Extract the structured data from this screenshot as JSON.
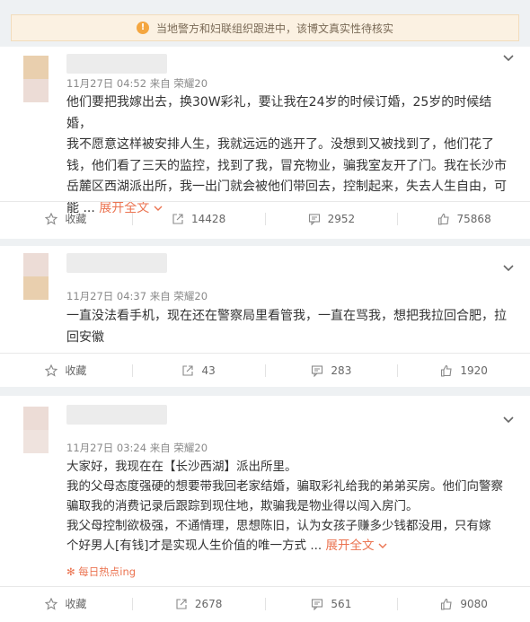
{
  "notice": {
    "text": "当地警方和妇联组织跟进中，该博文真实性待核实",
    "icon": "warning-icon"
  },
  "posts": [
    {
      "meta": "11月27日 04:52 来自 荣耀20",
      "lines": [
        "他们要把我嫁出去，换30W彩礼，要让我在24岁的时候订婚，25岁的时候结婚，",
        "我不愿意这样被安排人生，我就远远的逃开了。没想到又被找到了，他们花了",
        "钱，他们看了三天的监控，找到了我，冒充物业，骗我室友开了门。我在长沙市",
        "岳麓区西湖派出所，我一出门就会被他们带回去，控制起来，失去人生自由，可"
      ],
      "last_line": "能 ...",
      "expand": "展开全文",
      "actions": {
        "collect": "收藏",
        "repost": "14428",
        "comment": "2952",
        "like": "75868"
      }
    },
    {
      "meta": "11月27日 04:37 来自 荣耀20",
      "lines": [
        "一直没法看手机，现在还在警察局里看管我，一直在骂我，想把我拉回合肥，拉",
        "回安徽"
      ],
      "actions": {
        "collect": "收藏",
        "repost": "43",
        "comment": "283",
        "like": "1920"
      }
    },
    {
      "meta": "11月27日 03:24 来自 荣耀20",
      "lines": [
        "大家好，我现在在【长沙西湖】派出所里。",
        "我的父母态度强硬的想要带我回老家结婚，骗取彩礼给我的弟弟买房。他们向警察",
        "骗取我的消费记录后跟踪到现住地，欺骗我是物业得以闯入房门。",
        "我父母控制欲极强，不通情理，思想陈旧，认为女孩子赚多少钱都没用，只有嫁"
      ],
      "last_line": "个好男人[有钱]才是实现人生价值的唯一方式 ...",
      "expand": "展开全文",
      "tag": "每日热点ing",
      "actions": {
        "collect": "收藏",
        "repost": "2678",
        "comment": "561",
        "like": "9080"
      }
    }
  ]
}
